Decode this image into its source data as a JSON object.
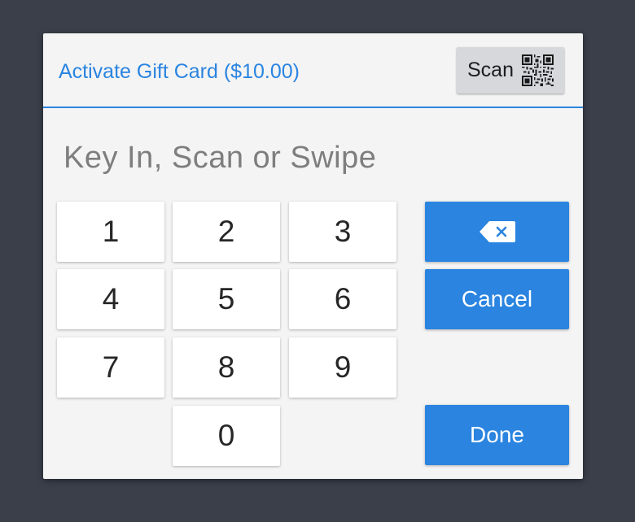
{
  "dialog": {
    "title": "Activate Gift Card ($10.00)",
    "scan_button": {
      "label": "Scan",
      "icon": "qr-code-icon"
    },
    "prompt": "Key In, Scan or Swipe"
  },
  "keypad": {
    "keys": [
      "1",
      "2",
      "3",
      "4",
      "5",
      "6",
      "7",
      "8",
      "9",
      "0"
    ]
  },
  "actions": {
    "backspace_icon": "backspace-icon",
    "cancel_label": "Cancel",
    "done_label": "Done"
  },
  "colors": {
    "accent": "#2a84e0",
    "background": "#3a3f4a",
    "dialog": "#f4f4f4",
    "key": "#ffffff",
    "prompt_text": "#7e7e7e"
  }
}
